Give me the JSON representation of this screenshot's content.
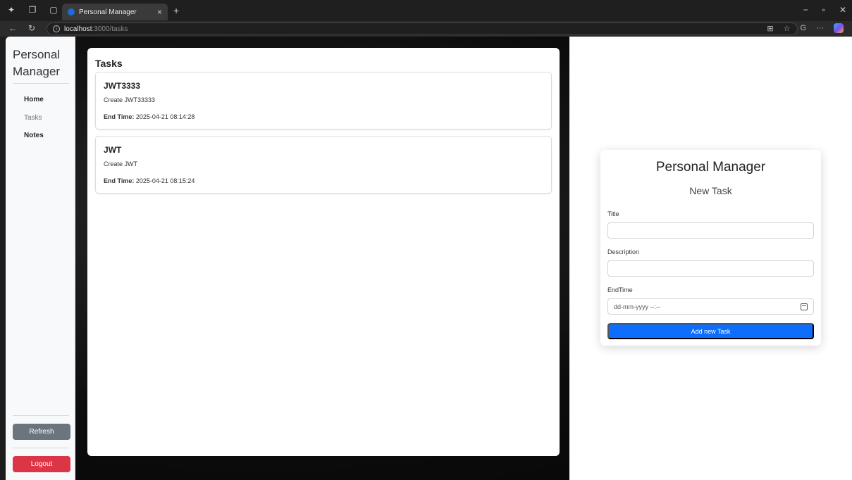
{
  "browser": {
    "tab_title": "Personal Manager",
    "url_host": "localhost",
    "url_path": ":3000/tasks"
  },
  "sidebar": {
    "brand": "Personal Manager",
    "items": [
      {
        "label": "Home",
        "state": "bold"
      },
      {
        "label": "Tasks",
        "state": "muted"
      },
      {
        "label": "Notes",
        "state": "bold"
      }
    ],
    "refresh_label": "Refresh",
    "logout_label": "Logout"
  },
  "tasks": {
    "heading": "Tasks",
    "end_time_label": "End Time:",
    "items": [
      {
        "title": "JWT3333",
        "description": "Create JWT33333",
        "end_time": "2025-04-21 08:14:28"
      },
      {
        "title": "JWT",
        "description": "Create JWT",
        "end_time": "2025-04-21 08:15:24"
      }
    ]
  },
  "form": {
    "brand": "Personal Manager",
    "subtitle": "New Task",
    "title_label": "Title",
    "title_value": "",
    "description_label": "Description",
    "description_value": "",
    "endtime_label": "EndTime",
    "endtime_placeholder": "dd-mm-yyyy --:--",
    "submit_label": "Add new Task"
  },
  "colors": {
    "primary": "#0d6efd",
    "secondary": "#6c757d",
    "danger": "#dc3545"
  }
}
